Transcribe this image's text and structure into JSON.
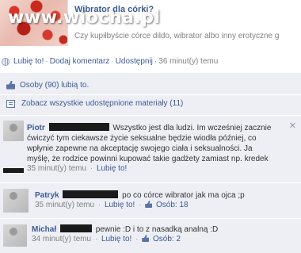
{
  "share": {
    "title": "Wibrator dla córki?",
    "description": "Czy kupiłbyście córce dildo, wibrator albo inny erotyczne g",
    "watermark": "www.wiocha.pl"
  },
  "actions": {
    "like": "Lubię to!",
    "comment": "Dodaj komentarz",
    "share": "Udostępnij",
    "time": "36 minut(y) temu"
  },
  "feedback": {
    "likes_text": "Osoby (90) lubią to.",
    "shares_text": "Zobacz wszystkie udostępnione materiały (11)"
  },
  "comments": [
    {
      "author": "Piotr",
      "lines": [
        "Wszystko jest dla ludzi. Im wcześniej zacznie",
        "ćwiczyć tym ciekawsze życie seksualne będzie wiodła później, co",
        "wpłynie zapewne na akceptację swojego ciała i seksualności. Ja",
        "myślę, że rodzice powinni kupować takie gadżety zamiast np. kredek"
      ],
      "time": "35 minut(y) temu",
      "like": "Lubię to!"
    },
    {
      "author": "Patryk",
      "text": "po co córce wibrator jak ma ojca ;p",
      "time": "35 minut(y) temu",
      "like": "Lubię to!",
      "likes": "Osób: 18"
    },
    {
      "author": "Michał",
      "text": "pewnie :D i to z nasadką analną :D",
      "time": "34 minut(y) temu",
      "like": "Lubię to!",
      "likes": "Osób: 2"
    }
  ],
  "icons": [
    "globe-icon",
    "thumbs-up-icon",
    "share-icon",
    "close-icon",
    "avatar"
  ],
  "colors": {
    "link": "#3b5998",
    "feedback_bg": "#edeff4",
    "muted": "#808080"
  }
}
